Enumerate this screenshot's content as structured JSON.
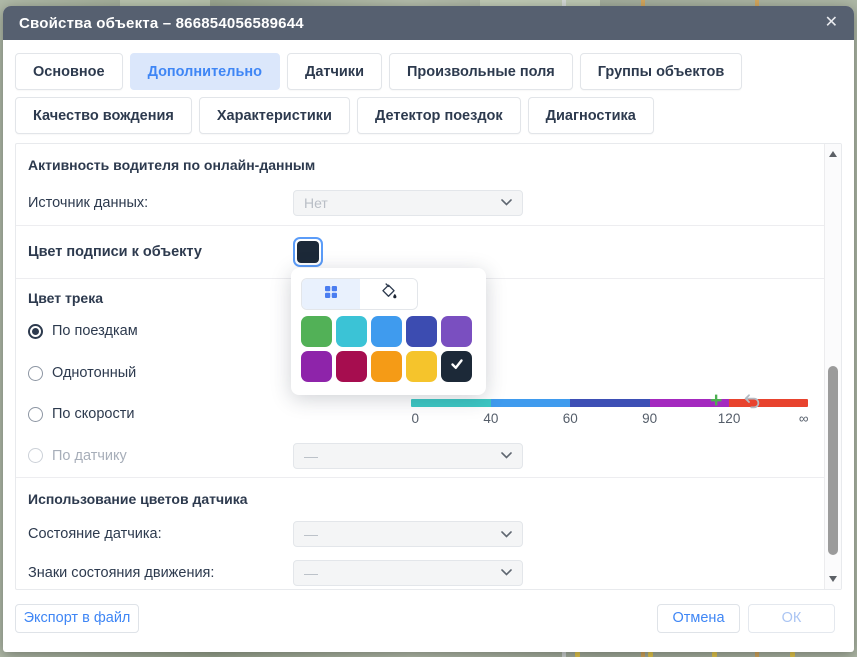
{
  "window": {
    "title": "Свойства объекта – 866854056589644",
    "close_icon": "✕"
  },
  "tabs": {
    "active": "Дополнительно",
    "row1": [
      "Основное",
      "Дополнительно",
      "Датчики",
      "Произвольные поля",
      "Группы объектов",
      "Качество вождения"
    ],
    "row2": [
      "Характеристики",
      "Детектор поездок",
      "Диагностика"
    ]
  },
  "driver_activity": {
    "section_title": "Активность водителя по онлайн-данным",
    "source_label": "Источник данных:",
    "source_value": "Нет"
  },
  "label_color": {
    "label": "Цвет подписи к объекту",
    "value_hex": "#1c2938"
  },
  "track_color": {
    "label": "Цвет трека",
    "options": [
      {
        "label": "По поездкам",
        "state": "selected"
      },
      {
        "label": "Однотонный",
        "state": "unselected"
      },
      {
        "label": "По скорости",
        "state": "unselected"
      },
      {
        "label": "По датчику",
        "state": "disabled"
      }
    ],
    "sensor_select_value": "—",
    "speed_scale": {
      "segments": [
        "#3cc7c4",
        "#3f9bee",
        "#3d4fb5",
        "#a429bf",
        "#e8432e"
      ],
      "labels": [
        "0",
        "40",
        "60",
        "90",
        "120",
        "∞"
      ]
    }
  },
  "color_picker": {
    "tab_icons": [
      "palette-grid",
      "fill-bucket"
    ],
    "swatches": [
      "#52b157",
      "#3bc3d6",
      "#3f9bee",
      "#3c4cb1",
      "#7a4fc0",
      "#8e24aa",
      "#a60d4f",
      "#f59b16",
      "#f5c42c",
      "#1c2938"
    ],
    "selected_index": 9
  },
  "sensor_colors": {
    "section_title": "Использование цветов датчика",
    "rows": [
      {
        "label": "Состояние датчика:",
        "value": "—"
      },
      {
        "label": "Знаки состояния движения:",
        "value": "—"
      }
    ]
  },
  "footer": {
    "export_label": "Экспорт в файл",
    "cancel_label": "Отмена",
    "ok_label": "ОК"
  },
  "colors": {
    "accent_blue": "#3f86f5",
    "header_bg": "#566070",
    "active_tab_bg": "#dbe7fb",
    "plus_green": "#4caf50"
  }
}
